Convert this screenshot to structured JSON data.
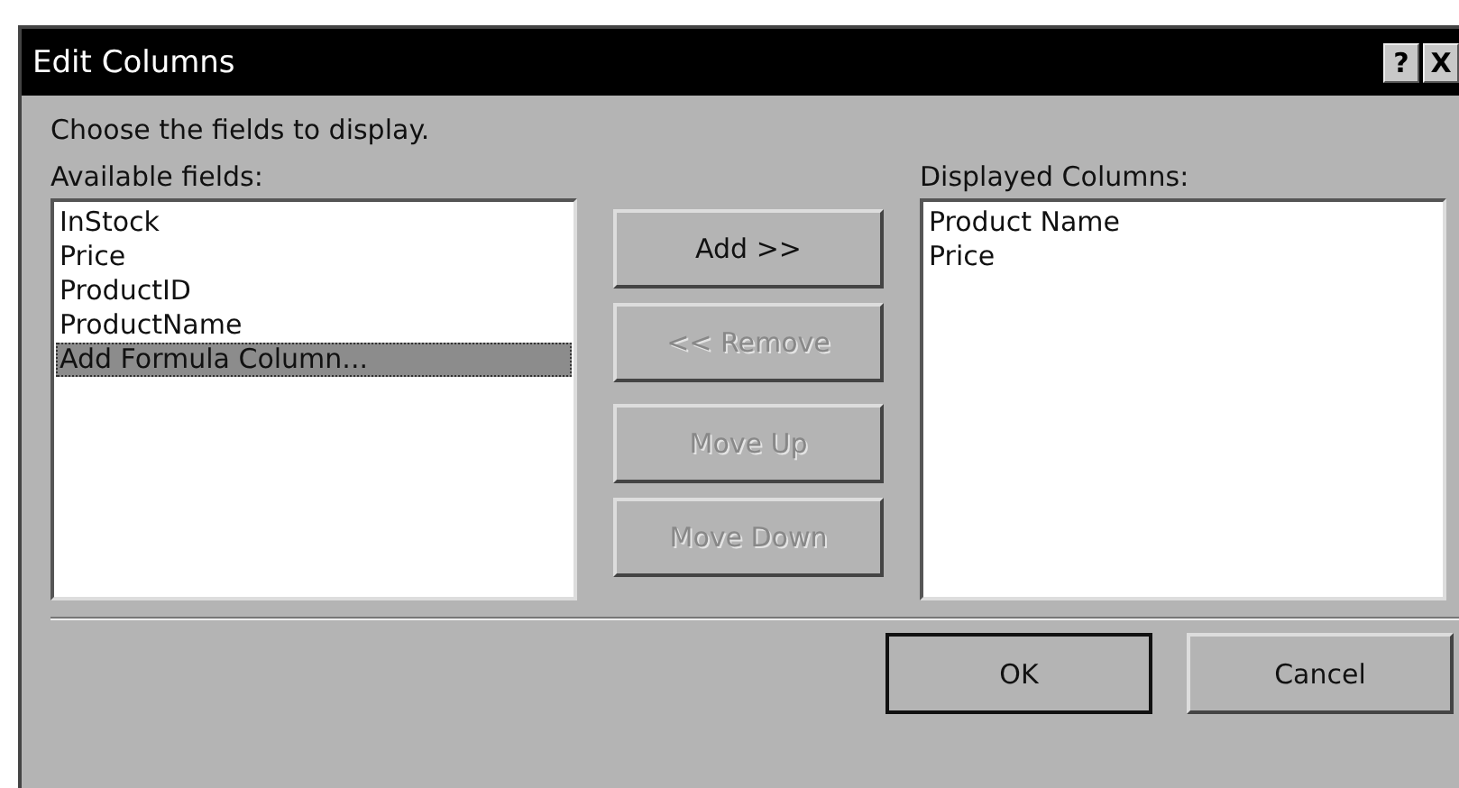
{
  "window": {
    "title": "Edit Columns",
    "title_buttons": [
      "?",
      "X"
    ]
  },
  "prompt": "Choose the fields to display.",
  "available": {
    "label": "Available fields:",
    "items": [
      {
        "text": "InStock",
        "selected": false
      },
      {
        "text": "Price",
        "selected": false
      },
      {
        "text": "ProductID",
        "selected": false
      },
      {
        "text": "ProductName",
        "selected": false
      },
      {
        "text": "Add Formula Column...",
        "selected": true
      }
    ]
  },
  "actions": [
    {
      "label": "Add >>",
      "disabled": false
    },
    {
      "label": "<< Remove",
      "disabled": true
    },
    {
      "label": "Move Up",
      "disabled": true
    },
    {
      "label": "Move Down",
      "disabled": true
    }
  ],
  "displayed": {
    "label": "Displayed Columns:",
    "items": [
      {
        "text": "Product Name",
        "selected": false
      },
      {
        "text": "Price",
        "selected": false
      }
    ]
  },
  "buttons": [
    {
      "label": "OK",
      "default": true
    },
    {
      "label": "Cancel",
      "default": false
    }
  ]
}
